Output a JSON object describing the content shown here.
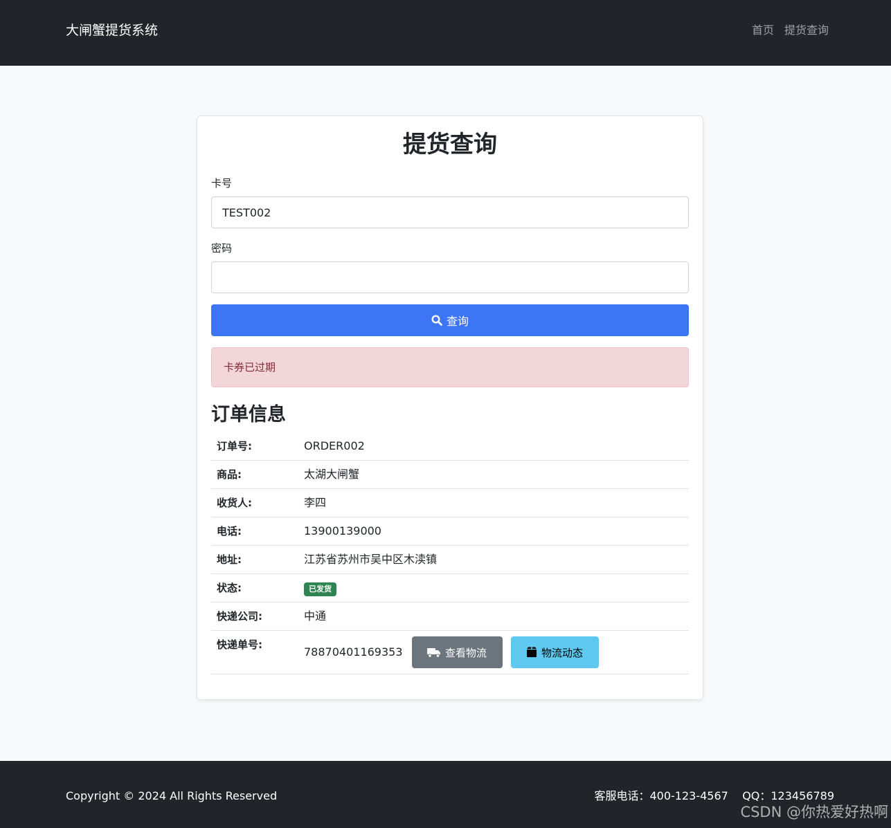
{
  "nav": {
    "brand": "大闸蟹提货系统",
    "links": [
      "首页",
      "提货查询"
    ]
  },
  "form": {
    "title": "提货查询",
    "card_label": "卡号",
    "card_value": "TEST002",
    "password_label": "密码",
    "password_value": "",
    "search_button": "查询"
  },
  "alert": {
    "message": "卡券已过期"
  },
  "order": {
    "section_title": "订单信息",
    "rows": [
      {
        "key": "订单号:",
        "value": "ORDER002"
      },
      {
        "key": "商品:",
        "value": "太湖大闸蟹"
      },
      {
        "key": "收货人:",
        "value": "李四"
      },
      {
        "key": "电话:",
        "value": "13900139000"
      },
      {
        "key": "地址:",
        "value": "江苏省苏州市吴中区木渎镇"
      },
      {
        "key": "状态:",
        "value": "已发货"
      },
      {
        "key": "快递公司:",
        "value": "中通"
      },
      {
        "key": "快递单号:",
        "value": "78870401169353"
      }
    ],
    "view_logistics_button": "查看物流",
    "logistics_updates_button": "物流动态"
  },
  "footer": {
    "copyright": "Copyright © 2024 All Rights Reserved",
    "contact": "客服电话：400-123-4567    QQ：123456789"
  },
  "watermark": "CSDN @你热爱好热啊",
  "colors": {
    "navbar": "#212529",
    "primary": "#3d76f4",
    "alert_bg": "#f2d6da",
    "badge": "#2f8551",
    "gray_button": "#6c757d",
    "cyan_button": "#5ec8ef"
  },
  "icons": [
    "search-icon",
    "truck-icon",
    "box-icon"
  ]
}
